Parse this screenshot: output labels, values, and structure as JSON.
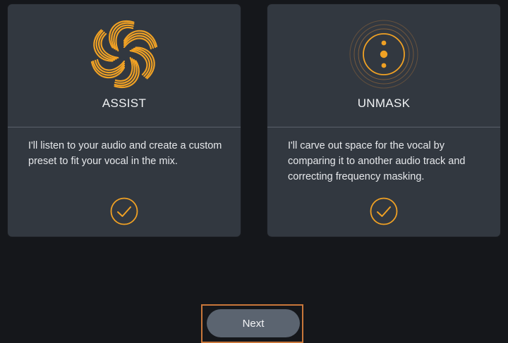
{
  "accent_color": "#f0a124",
  "cards": [
    {
      "icon": "flower-swirl-icon",
      "title": "ASSIST",
      "description": "I'll listen to your audio and create a custom preset to fit your vocal in the mix.",
      "checked": true
    },
    {
      "icon": "concentric-rings-icon",
      "title": "UNMASK",
      "description": "I'll carve out space for the vocal by comparing it to another audio track and correcting frequency masking.",
      "checked": true
    }
  ],
  "footer": {
    "next_label": "Next"
  }
}
